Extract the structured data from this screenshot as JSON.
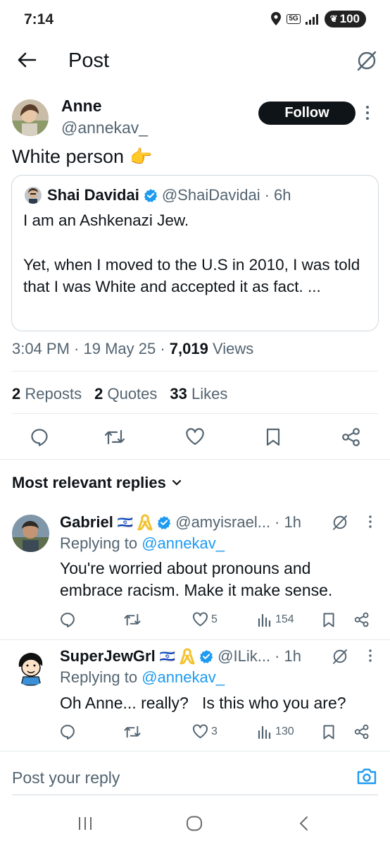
{
  "status_bar": {
    "time": "7:14",
    "network": "5G",
    "battery": "100"
  },
  "header": {
    "title": "Post"
  },
  "post": {
    "author_name": "Anne",
    "author_handle": "@annekav_",
    "follow_label": "Follow",
    "text": "White person",
    "emoji": "👉",
    "quote": {
      "author_name": "Shai Davidai",
      "author_handle": "@ShaiDavidai",
      "time": "· 6h",
      "line1": "I am an Ashkenazi Jew.",
      "line2": "Yet, when I moved to the U.S in 2010, I was told that I was White and accepted it as fact. ..."
    },
    "timestamp": "3:04 PM · 19 May 25 · ",
    "views_count": "7,019",
    "views_label": " Views",
    "stats": {
      "reposts_count": "2",
      "reposts_label": "Reposts",
      "quotes_count": "2",
      "quotes_label": "Quotes",
      "likes_count": "33",
      "likes_label": "Likes"
    }
  },
  "replies_header": "Most relevant replies",
  "replies": [
    {
      "name": "Gabriel",
      "flag": "🇮🇱",
      "handle": "@amyisrael...",
      "time": "· 1h",
      "replying_to": "Replying to ",
      "replying_handle": "@annekav_",
      "text": "You're worried about pronouns and embrace racism. Make it make sense.",
      "likes": "5",
      "views": "154"
    },
    {
      "name": "SuperJewGrl",
      "flag": "🇮🇱",
      "handle": "@ILik...",
      "time": "· 1h",
      "replying_to": "Replying to ",
      "replying_handle": "@annekav_",
      "text": "Oh Anne... really?   Is this who you are?",
      "likes": "3",
      "views": "130"
    }
  ],
  "composer": {
    "placeholder": "Post your reply"
  },
  "colors": {
    "accent": "#1d9bf0",
    "text": "#0f1419",
    "muted": "#536471",
    "ribbon": "#f2c230"
  }
}
